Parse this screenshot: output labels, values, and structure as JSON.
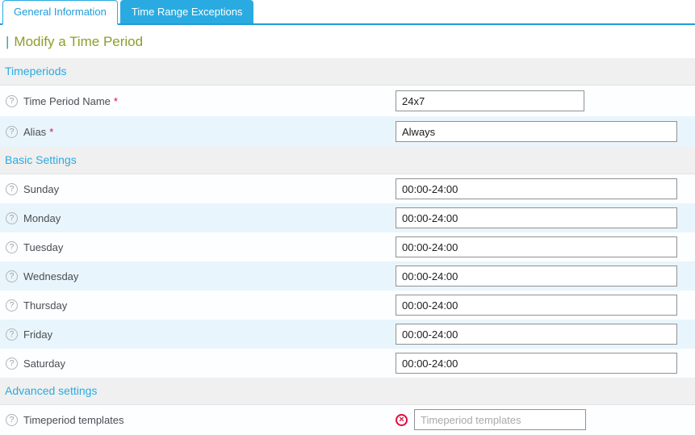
{
  "tabs": [
    {
      "label": "General Information",
      "active": true
    },
    {
      "label": "Time Range Exceptions",
      "active": false
    }
  ],
  "title": {
    "bar": "|",
    "text": "Modify a Time Period"
  },
  "icons": {
    "help": "?",
    "delete": "×"
  },
  "ui": {
    "required_mark": "*"
  },
  "sections": [
    {
      "header": "Timeperiods",
      "rows": [
        {
          "label": "Time Period Name",
          "required": true,
          "value": "24x7"
        },
        {
          "label": "Alias",
          "required": true,
          "value": "Always"
        }
      ]
    },
    {
      "header": "Basic Settings",
      "rows": [
        {
          "label": "Sunday",
          "value": "00:00-24:00"
        },
        {
          "label": "Monday",
          "value": "00:00-24:00"
        },
        {
          "label": "Tuesday",
          "value": "00:00-24:00"
        },
        {
          "label": "Wednesday",
          "value": "00:00-24:00"
        },
        {
          "label": "Thursday",
          "value": "00:00-24:00"
        },
        {
          "label": "Friday",
          "value": "00:00-24:00"
        },
        {
          "label": "Saturday",
          "value": "00:00-24:00"
        }
      ]
    },
    {
      "header": "Advanced settings",
      "rows": [
        {
          "label": "Timeperiod templates",
          "placeholder": "Timeperiod templates"
        }
      ]
    }
  ],
  "colors": {
    "accent": "#29abe2",
    "tab_underline": "#1f9cd9",
    "row_alt": "#e9f5fc",
    "section_bg": "#f0f0f0",
    "title_text": "#8e9c2c",
    "required": "#e00b3d",
    "delete_icon": "#e00b3d"
  }
}
